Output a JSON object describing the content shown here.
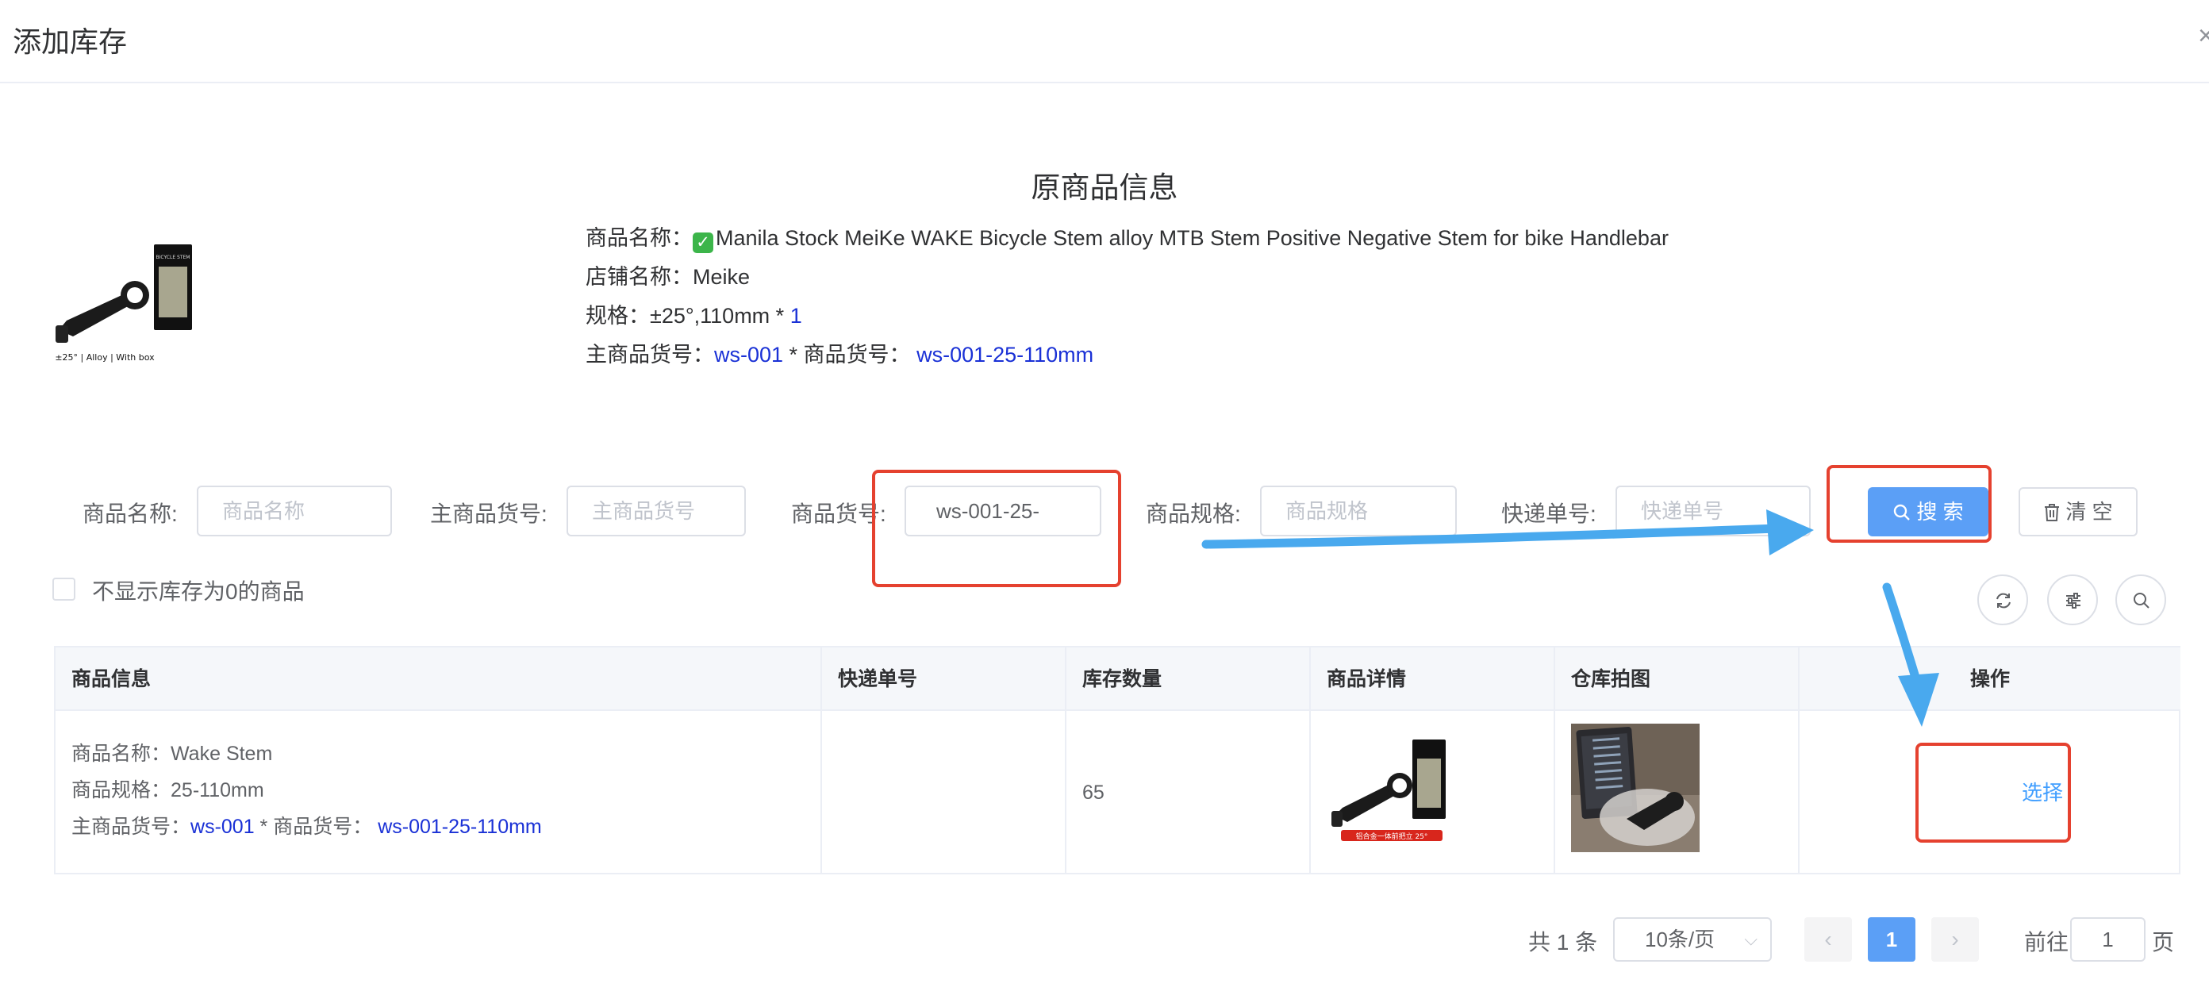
{
  "dialog": {
    "title": "添加库存",
    "close_icon": "close-icon"
  },
  "original": {
    "title": "原商品信息",
    "name_label": "商品名称：",
    "name_value": "Manila Stock MeiKe WAKE Bicycle Stem alloy MTB Stem Positive Negative Stem for bike Handlebar",
    "shop_label": "店铺名称：",
    "shop_value": "Meike",
    "spec_label": "规格：",
    "spec_value": "±25°,110mm * ",
    "spec_qty": "1",
    "main_sku_label": "主商品货号：",
    "main_sku_value": "ws-001",
    "sku_sep": " * 商品货号：",
    "sku_value": "ws-001-25-110mm",
    "image_caption": "±25° | Alloy | With box",
    "box_text": "BICYCLE STEM"
  },
  "filters": {
    "name_label": "商品名称:",
    "name_placeholder": "商品名称",
    "main_sku_label": "主商品货号:",
    "main_sku_placeholder": "主商品货号",
    "sku_label": "商品货号:",
    "sku_value": "ws-001-25-",
    "spec_label": "商品规格:",
    "spec_placeholder": "商品规格",
    "tracking_label": "快递单号:",
    "tracking_placeholder": "快递单号",
    "search_button": "搜 索",
    "clear_button": "清 空",
    "hide_zero_label": "不显示库存为0的商品",
    "hide_zero_checked": false
  },
  "table": {
    "headers": [
      "商品信息",
      "快递单号",
      "库存数量",
      "商品详情",
      "仓库拍图",
      "操作"
    ],
    "rows": [
      {
        "name_label": "商品名称：",
        "name": "Wake Stem",
        "spec_label": "商品规格：",
        "spec": "25-110mm",
        "main_sku_label": "主商品货号：",
        "main_sku": "ws-001",
        "sku_sep": " * 商品货号：",
        "sku": "ws-001-25-110mm",
        "tracking": "",
        "stock": "65",
        "detail_banner": "铝合金一体前把立 25°",
        "action": "选择"
      }
    ]
  },
  "pagination": {
    "total": "共 1 条",
    "page_size": "10条/页",
    "current_page": "1",
    "goto_label": "前往",
    "goto_value": "1",
    "page_suffix": "页",
    "prev_icon": "chevron-left-icon",
    "next_icon": "chevron-right-icon"
  },
  "colors": {
    "primary": "#5b9ff6",
    "link": "#409eff",
    "sku_blue": "#1a31d6",
    "annotation_red": "#e5412f",
    "annotation_arrow": "#49a9ee"
  }
}
